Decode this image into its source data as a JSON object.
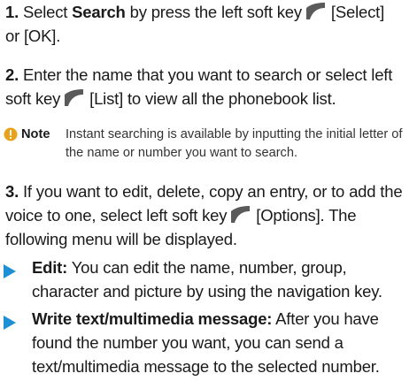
{
  "steps": [
    {
      "num": "1.",
      "pre": "Select",
      "bold": "Search",
      "mid": "by press the left soft key",
      "key1": "[Select]",
      "post": "or [OK]."
    },
    {
      "num": "2.",
      "pre": "Enter the name that you want to search or select left soft key",
      "key1": "[List]",
      "post": "to view all the phonebook list."
    },
    {
      "num": "3.",
      "pre": "If you want to edit, delete, copy an entry, or to add the voice to one, select left soft key",
      "key1": "[Options].",
      "post": "The following menu will be displayed."
    }
  ],
  "note": {
    "label": "Note",
    "text": "Instant searching is available by inputting the initial letter of the name or number you want to search."
  },
  "bullets": [
    {
      "title": "Edit:",
      "text": "You can edit the name, number, group, character and picture by using the navigation key."
    },
    {
      "title": "Write text/multimedia message:",
      "text": "After you have found the number you want, you can send a text/multimedia message to the selected number."
    }
  ],
  "colors": {
    "accent": "#1e90d6",
    "softkey": "#5a5a5a"
  },
  "icons": {
    "softkey": "left-soft-key-icon",
    "note": "info-icon",
    "bullet": "triangle-bullet-icon"
  }
}
